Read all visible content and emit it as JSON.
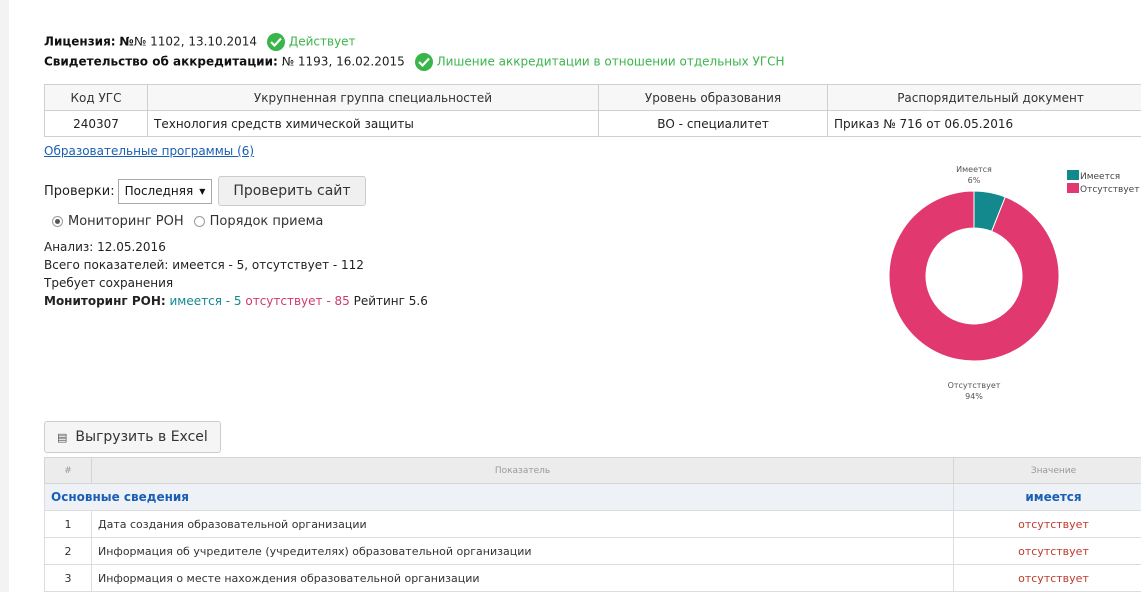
{
  "license": {
    "label": "Лицензия:",
    "value": "№ 1102, 13.10.2014",
    "status": "Действует"
  },
  "accreditation": {
    "label": "Свидетельство об аккредитации:",
    "value": "№ 1193, 16.02.2015",
    "status": "Лишение аккредитации в отношении отдельных УГСН"
  },
  "ugs_table": {
    "headers": [
      "Код УГС",
      "Укрупненная группа специальностей",
      "Уровень образования",
      "Распорядительный документ"
    ],
    "rows": [
      [
        "240307",
        "Технология средств химической защиты",
        "ВО - специалитет",
        "Приказ № 716 от 06.05.2016"
      ]
    ]
  },
  "programs_link": "Образовательные программы (6)",
  "checks": {
    "label": "Проверки:",
    "selected": "Последняя",
    "button": "Проверить сайт"
  },
  "radios": [
    {
      "label": "Мониторинг РОН",
      "checked": true
    },
    {
      "label": "Порядок приема",
      "checked": false
    }
  ],
  "analysis": {
    "date_line": "Анализ: 12.05.2016",
    "total_line": "Всего показателей: имеется - 5, отсутствует - 112",
    "save_line": "Требует сохранения",
    "monitoring_label": "Мониторинг РОН:",
    "has_text": "имеется - 5",
    "missing_text": "отсутствует - 85",
    "rating_text": "Рейтинг 5.6"
  },
  "chart_data": {
    "type": "pie",
    "donut": true,
    "categories": [
      "Имеется",
      "Отсутствует"
    ],
    "values": [
      6,
      94
    ],
    "value_labels": [
      "6%",
      "94%"
    ],
    "colors": [
      "#13898d",
      "#e0386f"
    ],
    "legend": [
      "Имеется",
      "Отсутствует"
    ],
    "legend_position": "top-right"
  },
  "export_button": "Выгрузить в Excel",
  "indicators": {
    "headers": [
      "#",
      "Показатель",
      "Значение"
    ],
    "section": {
      "label": "Основные сведения",
      "value": "имеется"
    },
    "rows": [
      {
        "n": "1",
        "name": "Дата создания образовательной организации",
        "value": "отсутствует"
      },
      {
        "n": "2",
        "name": "Информация об учредителе (учредителях) образовательной организации",
        "value": "отсутствует"
      },
      {
        "n": "3",
        "name": "Информация о месте нахождения образовательной организации",
        "value": "отсутствует"
      }
    ]
  }
}
